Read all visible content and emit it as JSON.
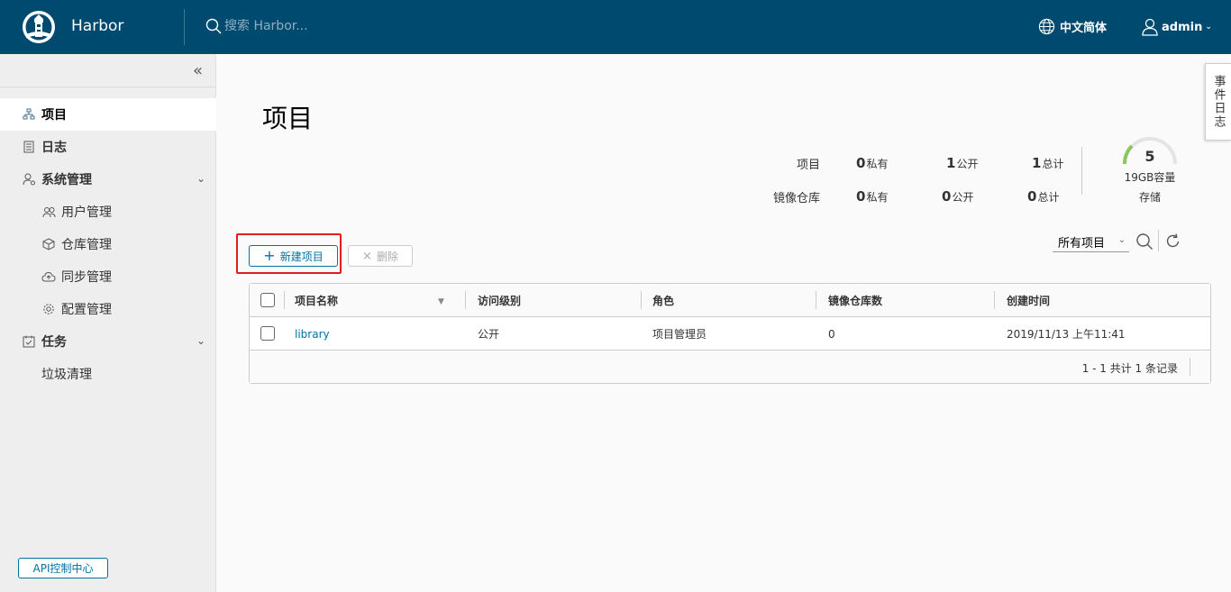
{
  "header": {
    "brand": "Harbor",
    "search_placeholder": "搜索 Harbor...",
    "language": "中文简体",
    "user": "admin"
  },
  "sidebar": {
    "items": [
      {
        "label": "项目",
        "icon": "projects-icon",
        "active": true
      },
      {
        "label": "日志",
        "icon": "logs-icon"
      },
      {
        "label": "系统管理",
        "icon": "admin-icon",
        "expandable": true
      },
      {
        "label": "任务",
        "icon": "tasks-icon",
        "expandable": true
      }
    ],
    "admin_sub": [
      {
        "label": "用户管理",
        "icon": "users-icon"
      },
      {
        "label": "仓库管理",
        "icon": "registry-icon"
      },
      {
        "label": "同步管理",
        "icon": "replication-icon"
      },
      {
        "label": "配置管理",
        "icon": "config-icon"
      }
    ],
    "task_sub": [
      {
        "label": "垃圾清理"
      }
    ],
    "api_button": "API控制中心"
  },
  "main": {
    "title": "项目",
    "stats": {
      "projects_label": "项目",
      "repos_label": "镜像仓库",
      "private_suffix": "私有",
      "public_suffix": "公开",
      "total_suffix": "总计",
      "projects": {
        "private": "0",
        "public": "1",
        "total": "1"
      },
      "repos": {
        "private": "0",
        "public": "0",
        "total": "0"
      }
    },
    "storage": {
      "value": "5",
      "capacity": "19GB容量",
      "label": "存储"
    },
    "actions": {
      "new_project": "新建项目",
      "delete": "删除"
    },
    "filter": {
      "selected": "所有项目"
    },
    "table": {
      "columns": [
        "项目名称",
        "访问级别",
        "角色",
        "镜像仓库数",
        "创建时间"
      ],
      "rows": [
        {
          "name": "library",
          "access": "公开",
          "role": "项目管理员",
          "repo_count": "0",
          "created": "2019/11/13 上午11:41"
        }
      ],
      "footer": "1 - 1 共计 1 条记录"
    }
  },
  "event_tab": "事件日志",
  "colors": {
    "header_bg": "#004a70",
    "accent": "#0072a3",
    "highlight": "#e02020",
    "gauge_green": "#8dc561"
  }
}
